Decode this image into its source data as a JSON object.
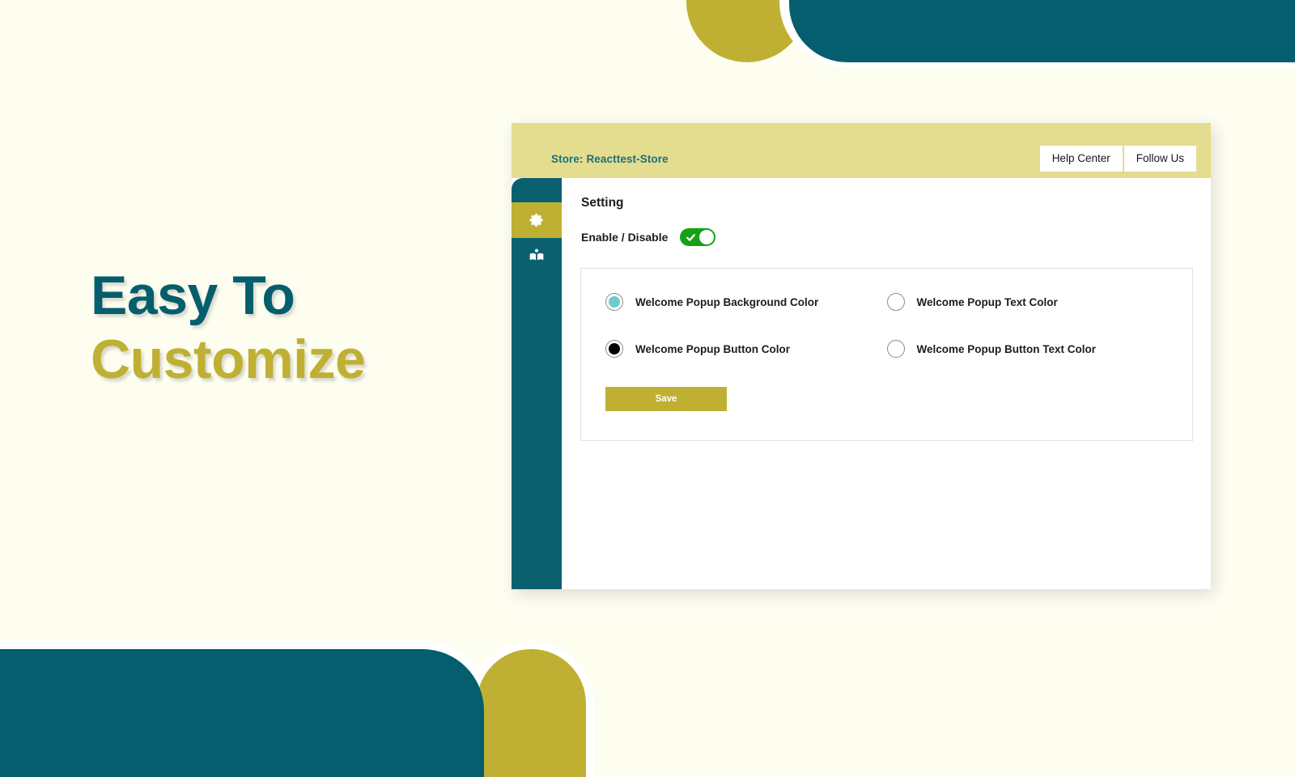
{
  "page": {
    "background_color": "#FDFDF0",
    "headline_line1": "Easy To",
    "headline_line2": "Customize",
    "headline_color1": "#045E6D",
    "headline_color2": "#BFB033"
  },
  "decor": {
    "teal": "#045E6D",
    "olive": "#BFB033",
    "white": "#FFFFFF"
  },
  "app": {
    "topbar": {
      "store_label": "Store: Reacttest-Store",
      "store_label_color": "#18707F",
      "background_color": "#E4DC8F",
      "buttons": [
        {
          "label": "Help Center",
          "name": "help-center-button"
        },
        {
          "label": "Follow Us",
          "name": "follow-us-button"
        }
      ]
    },
    "sidebar": {
      "background_color": "#0B6070",
      "active_color": "#BFB033",
      "items": [
        {
          "icon": "gear-icon",
          "label": "Setting",
          "active": true
        },
        {
          "icon": "book-reader-icon",
          "label": "Docs",
          "active": false
        }
      ]
    },
    "content": {
      "title": "Setting",
      "toggle": {
        "label": "Enable / Disable",
        "state": "on",
        "on_color": "#16A016"
      },
      "options": [
        {
          "label": "Welcome Popup Background Color",
          "swatch_color": "#6FCBCB",
          "name": "welcome-popup-background-color"
        },
        {
          "label": "Welcome Popup Text Color",
          "swatch_color": "#FFFFFF",
          "name": "welcome-popup-text-color"
        },
        {
          "label": "Welcome Popup Button Color",
          "swatch_color": "#000000",
          "name": "welcome-popup-button-color"
        },
        {
          "label": "Welcome Popup Button Text Color",
          "swatch_color": "#FFFFFF",
          "name": "welcome-popup-button-text-color"
        }
      ],
      "save_label": "Save",
      "save_color": "#BFB033"
    }
  }
}
